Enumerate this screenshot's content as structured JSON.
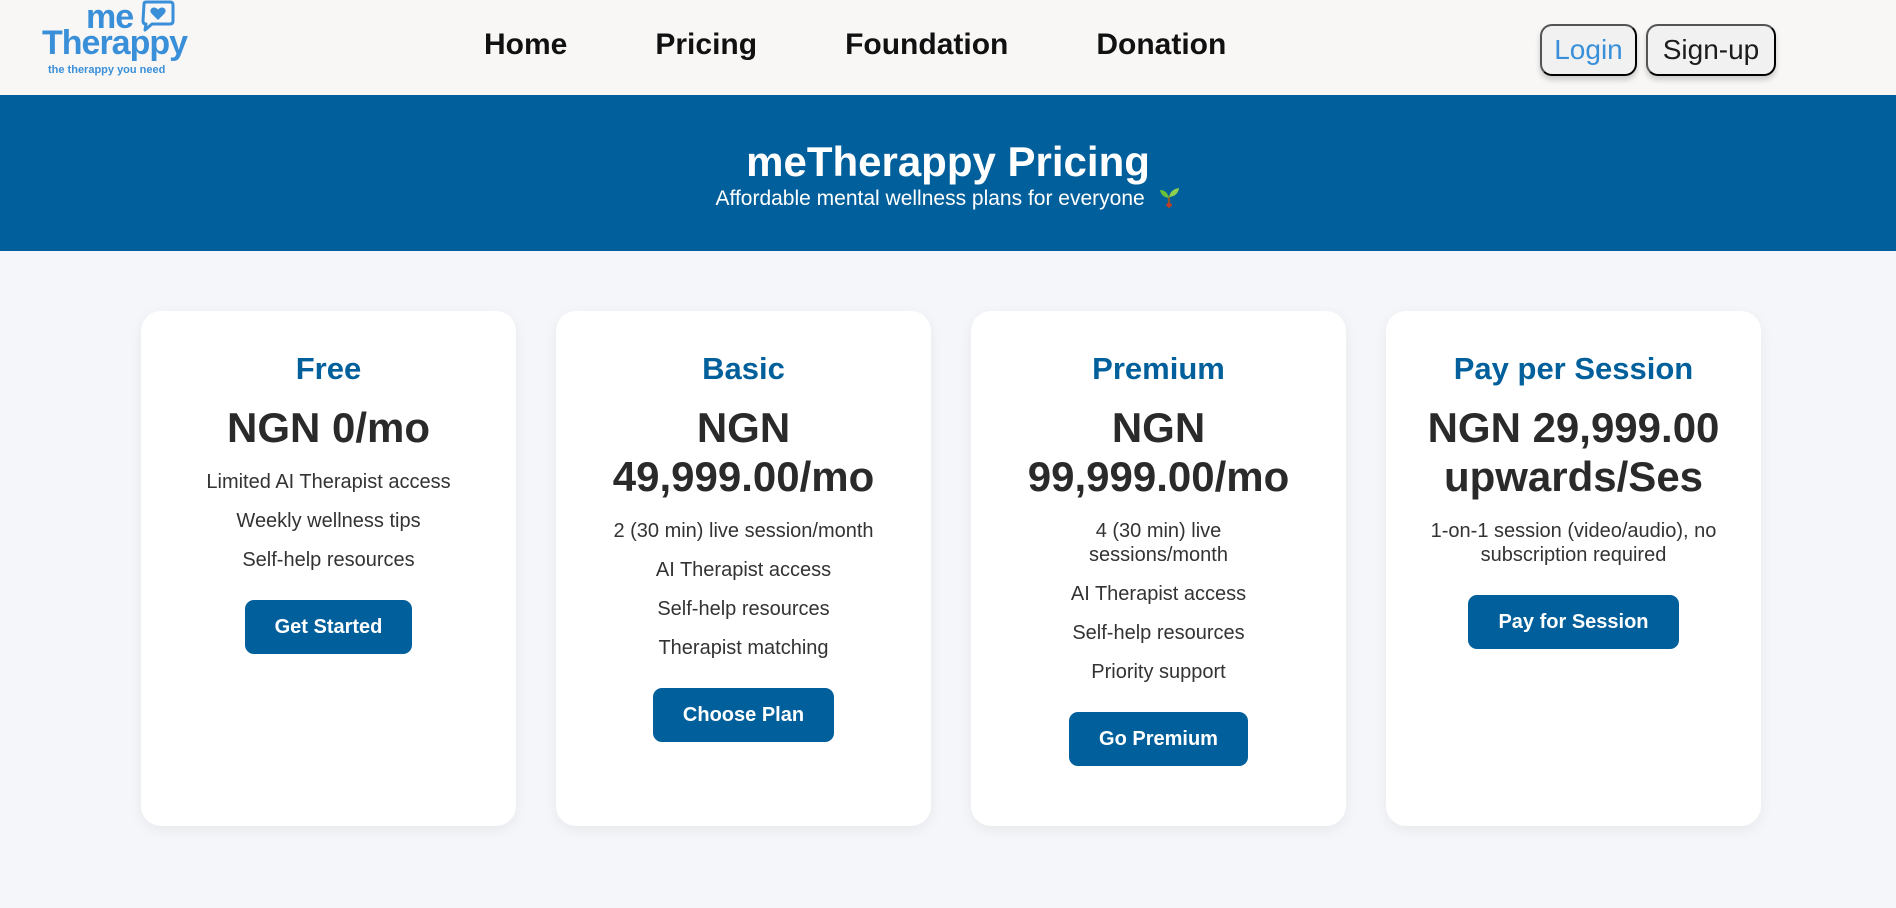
{
  "brand": {
    "logo_me": "me",
    "logo_word": "Therappy",
    "tagline": "the therappy you need",
    "color": "#3a8fd9"
  },
  "nav": {
    "links": [
      "Home",
      "Pricing",
      "Foundation",
      "Donation"
    ],
    "login_label": "Login",
    "signup_label": "Sign-up"
  },
  "hero": {
    "title": "meTherappy Pricing",
    "subtitle": "Affordable mental wellness plans for everyone",
    "icon": "sprout-icon",
    "background": "#01609b"
  },
  "plans": [
    {
      "name": "Free",
      "price": "NGN 0/mo",
      "features": [
        "Limited AI Therapist access",
        "Weekly wellness tips",
        "Self-help resources"
      ],
      "button": "Get Started"
    },
    {
      "name": "Basic",
      "price": "NGN 49,999.00/mo",
      "features": [
        "2 (30 min) live session/month",
        "AI Therapist access",
        "Self-help resources",
        "Therapist matching"
      ],
      "button": "Choose Plan"
    },
    {
      "name": "Premium",
      "price": "NGN 99,999.00/mo",
      "features": [
        "4 (30 min) live sessions/month",
        "AI Therapist access",
        "Self-help resources",
        "Priority support"
      ],
      "button": "Go Premium"
    },
    {
      "name": "Pay per Session",
      "price": "NGN 29,999.00 upwards/Ses",
      "features": [
        "1-on-1 session (video/audio), no subscription required"
      ],
      "button": "Pay for Session"
    }
  ],
  "colors": {
    "accent": "#01609b",
    "page_background": "#f4f6f9"
  }
}
